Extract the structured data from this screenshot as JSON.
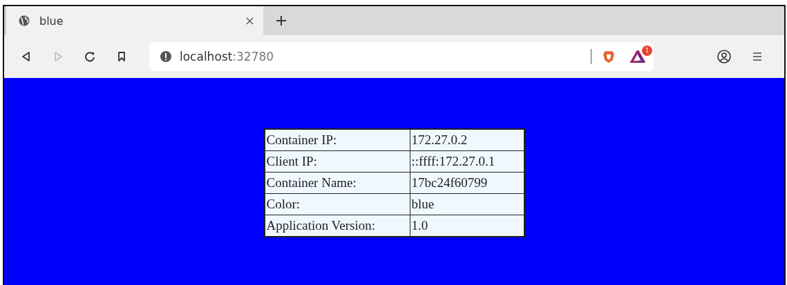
{
  "tabs": [
    {
      "title": "blue",
      "selected": true
    }
  ],
  "address_bar": {
    "host": "localhost",
    "port": ":32780"
  },
  "extension_badge": "1",
  "info_table": {
    "rows": [
      {
        "label": "Container IP:",
        "value": "172.27.0.2"
      },
      {
        "label": "Client IP:",
        "value": "::ffff:172.27.0.1"
      },
      {
        "label": "Container Name:",
        "value": "17bc24f60799"
      },
      {
        "label": "Color:",
        "value": "blue"
      },
      {
        "label": "Application Version:",
        "value": "1.0"
      }
    ]
  }
}
